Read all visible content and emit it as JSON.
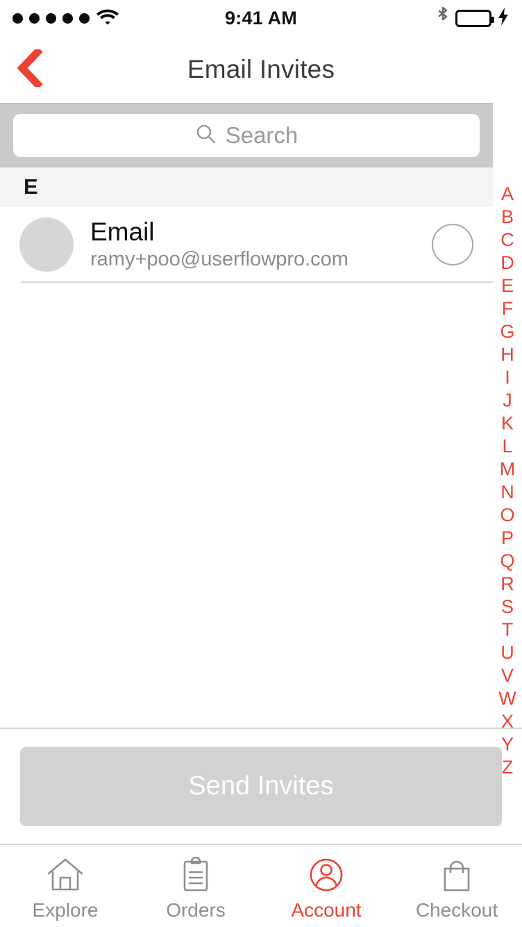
{
  "status_bar": {
    "signal_dots": 5,
    "wifi_icon": "wifi-icon",
    "time": "9:41 AM",
    "bluetooth_icon": "bluetooth-icon",
    "battery_icon": "battery-full-icon",
    "charging_icon": "lightning-bolt-icon",
    "battery_color": "#4cd437"
  },
  "nav": {
    "back_icon": "chevron-left-icon",
    "title": "Email Invites",
    "accent_color": "#ee4136"
  },
  "search": {
    "icon": "search-icon",
    "placeholder": "Search",
    "value": ""
  },
  "list": {
    "sections": [
      {
        "header": "E",
        "contacts": [
          {
            "name": "Email",
            "email": "ramy+poo@userflowpro.com",
            "avatar_icon": "avatar-placeholder",
            "selected": false
          }
        ]
      }
    ]
  },
  "alpha_index": {
    "letters": [
      "A",
      "B",
      "C",
      "D",
      "E",
      "F",
      "G",
      "H",
      "I",
      "J",
      "K",
      "L",
      "M",
      "N",
      "O",
      "P",
      "Q",
      "R",
      "S",
      "T",
      "U",
      "V",
      "W",
      "X",
      "Y",
      "Z"
    ],
    "color": "#ee4136"
  },
  "footer": {
    "send_label": "Send Invites",
    "send_enabled": false
  },
  "tab_bar": {
    "tabs": [
      {
        "label": "Explore",
        "icon": "home-icon",
        "active": false
      },
      {
        "label": "Orders",
        "icon": "clipboard-icon",
        "active": false
      },
      {
        "label": "Account",
        "icon": "account-circle-icon",
        "active": true
      },
      {
        "label": "Checkout",
        "icon": "shopping-bag-icon",
        "active": false
      }
    ],
    "active_color": "#ee4136",
    "inactive_color": "#8e8e92"
  }
}
